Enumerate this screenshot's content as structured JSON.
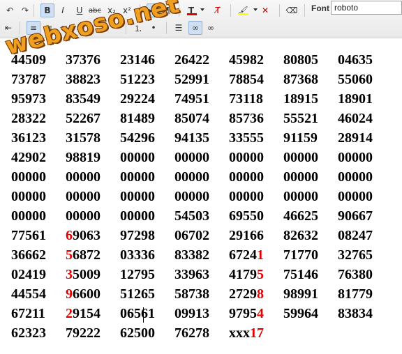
{
  "toolbar": {
    "font_label": "Font",
    "font_value": "roboto",
    "text_color": "#e00000",
    "highlight_color": "#ffff00",
    "row1_buttons": [
      {
        "name": "undo-icon",
        "glyph": "↶"
      },
      {
        "name": "redo-icon",
        "glyph": "↷"
      },
      {
        "name": "bold-button",
        "glyph": "B"
      },
      {
        "name": "italic-button",
        "glyph": "I"
      },
      {
        "name": "underline-button",
        "glyph": "U"
      },
      {
        "name": "strikethrough-button",
        "glyph": "abc"
      },
      {
        "name": "subscript-button",
        "glyph": "x₂"
      },
      {
        "name": "superscript-button",
        "glyph": "x²"
      },
      {
        "name": "ltr-paragraph-button",
        "glyph": "▸¶"
      },
      {
        "name": "rtl-paragraph-button",
        "glyph": "¶◂"
      },
      {
        "name": "text-color-button",
        "glyph": "T"
      },
      {
        "name": "clear-format-button",
        "glyph": "T̸"
      },
      {
        "name": "highlight-color-button",
        "glyph": "🖌"
      },
      {
        "name": "remove-highlight-button",
        "glyph": "✕"
      },
      {
        "name": "eraser-button",
        "glyph": "⌫"
      }
    ],
    "row2_buttons": [
      {
        "name": "outdent-icon",
        "glyph": "⇤"
      },
      {
        "name": "align-left-button",
        "glyph": "≡"
      },
      {
        "name": "align-center-button",
        "glyph": "≡"
      },
      {
        "name": "align-right-button",
        "glyph": "≡"
      },
      {
        "name": "justify-button",
        "glyph": "≡"
      },
      {
        "name": "numbered-list-button",
        "glyph": "⒈"
      },
      {
        "name": "bullet-list-button",
        "glyph": "•"
      },
      {
        "name": "horizontal-rule-button",
        "glyph": "☰"
      },
      {
        "name": "insert-link-button",
        "glyph": "∞"
      },
      {
        "name": "remove-link-button",
        "glyph": "∞"
      }
    ]
  },
  "watermark": "webxoso.net",
  "rows": [
    [
      {
        "t": "44509"
      },
      {
        "t": "37376"
      },
      {
        "t": "23146"
      },
      {
        "t": "26422"
      },
      {
        "t": "45982"
      },
      {
        "t": "80805"
      },
      {
        "t": "04635"
      }
    ],
    [
      {
        "t": "73787"
      },
      {
        "t": "38823"
      },
      {
        "t": "51223"
      },
      {
        "t": "52991"
      },
      {
        "t": "78854"
      },
      {
        "t": "87368"
      },
      {
        "t": "55060"
      }
    ],
    [
      {
        "t": "95973"
      },
      {
        "t": "83549"
      },
      {
        "t": "29224"
      },
      {
        "t": "74951"
      },
      {
        "t": "73118"
      },
      {
        "t": "18915"
      },
      {
        "t": "18901"
      }
    ],
    [
      {
        "t": "28322"
      },
      {
        "t": "52267"
      },
      {
        "t": "81489"
      },
      {
        "t": "85074"
      },
      {
        "t": "85736"
      },
      {
        "t": "55521"
      },
      {
        "t": "46024"
      }
    ],
    [
      {
        "t": "36123"
      },
      {
        "t": "31578"
      },
      {
        "t": "54296"
      },
      {
        "t": "94135"
      },
      {
        "t": "33555"
      },
      {
        "t": "91159"
      },
      {
        "t": "28914"
      }
    ],
    [
      {
        "t": "42902"
      },
      {
        "t": "98819"
      },
      {
        "t": "00000"
      },
      {
        "t": "00000"
      },
      {
        "t": "00000"
      },
      {
        "t": "00000"
      },
      {
        "t": "00000"
      }
    ],
    [
      {
        "t": "00000"
      },
      {
        "t": "00000"
      },
      {
        "t": "00000"
      },
      {
        "t": "00000"
      },
      {
        "t": "00000"
      },
      {
        "t": "00000"
      },
      {
        "t": "00000"
      }
    ],
    [
      {
        "t": "00000"
      },
      {
        "t": "00000"
      },
      {
        "t": "00000"
      },
      {
        "t": "00000"
      },
      {
        "t": "00000"
      },
      {
        "t": "00000"
      },
      {
        "t": "00000"
      }
    ],
    [
      {
        "t": "00000"
      },
      {
        "t": "00000"
      },
      {
        "t": "00000"
      },
      {
        "t": "54503"
      },
      {
        "t": "69550"
      },
      {
        "t": "46625"
      },
      {
        "t": "90667"
      }
    ],
    [
      {
        "t": "77561"
      },
      {
        "r": "6",
        "t": "9063"
      },
      {
        "t": "97298"
      },
      {
        "t": "06702"
      },
      {
        "t": "29166"
      },
      {
        "t": "82632"
      },
      {
        "t": "08247"
      }
    ],
    [
      {
        "t": "36662"
      },
      {
        "r": "5",
        "t": "6872"
      },
      {
        "t": "03336"
      },
      {
        "t": "83382"
      },
      {
        "t": "6724",
        "r2": "1"
      },
      {
        "t": "71770"
      },
      {
        "t": "32765"
      }
    ],
    [
      {
        "t": "02419"
      },
      {
        "r": "3",
        "t": "5009"
      },
      {
        "t": "12795"
      },
      {
        "t": "33963"
      },
      {
        "t": "4179",
        "r2": "5"
      },
      {
        "t": "75146"
      },
      {
        "t": "76380"
      }
    ],
    [
      {
        "t": "44554"
      },
      {
        "r": "9",
        "t": "6600"
      },
      {
        "t": "51265"
      },
      {
        "t": "58738"
      },
      {
        "t": "2729",
        "r2": "8"
      },
      {
        "t": "98991"
      },
      {
        "t": "81779"
      }
    ],
    [
      {
        "t": "67211"
      },
      {
        "r": "2",
        "t": "9154"
      },
      {
        "t": "06561"
      },
      {
        "t": "09913"
      },
      {
        "t": "9795",
        "r2": "4"
      },
      {
        "t": "59964"
      },
      {
        "t": "83834"
      }
    ],
    [
      {
        "t": "62323"
      },
      {
        "t": "79222"
      },
      {
        "t": "62500"
      },
      {
        "t": "76278"
      },
      {
        "t": "xxx",
        "r2": "17"
      }
    ]
  ]
}
